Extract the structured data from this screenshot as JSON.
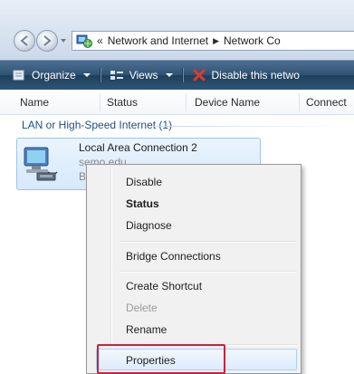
{
  "address": {
    "prefix": "«",
    "crumbs": [
      "Network and Internet",
      "Network Co"
    ],
    "separator": "▶"
  },
  "toolbar": {
    "organize": "Organize",
    "views": "Views",
    "disable": "Disable this netwo"
  },
  "columns": [
    "Name",
    "Status",
    "Device Name",
    "Connect"
  ],
  "group": {
    "label": "LAN or High-Speed Internet (1)"
  },
  "connection": {
    "name": "Local Area Connection 2",
    "domain": "semo.edu",
    "truncated": "B"
  },
  "context_menu": {
    "items": [
      {
        "label": "Disable",
        "style": "normal"
      },
      {
        "label": "Status",
        "style": "bold"
      },
      {
        "label": "Diagnose",
        "style": "normal"
      },
      {
        "label": "Bridge Connections",
        "style": "normal"
      },
      {
        "label": "Create Shortcut",
        "style": "normal"
      },
      {
        "label": "Delete",
        "style": "disabled"
      },
      {
        "label": "Rename",
        "style": "normal"
      },
      {
        "label": "Properties",
        "style": "highlighted"
      }
    ]
  },
  "colors": {
    "cmdbar": "#2e5577",
    "group_text": "#1f4f86",
    "callout": "#c8243a",
    "selection": "#d6e9fb"
  }
}
